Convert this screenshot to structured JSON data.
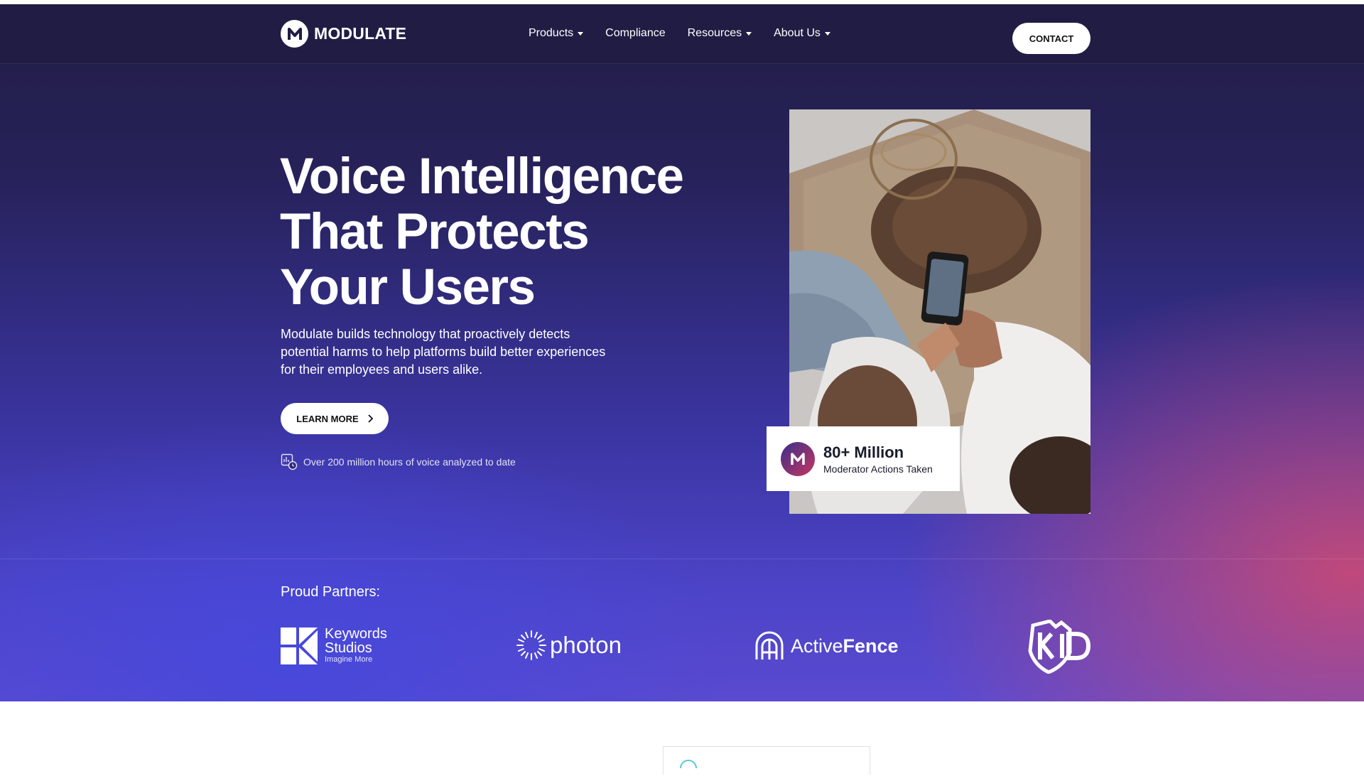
{
  "nav": {
    "logo_text": "MODULATE",
    "items": [
      {
        "label": "Products",
        "dropdown": true
      },
      {
        "label": "Compliance",
        "dropdown": false
      },
      {
        "label": "Resources",
        "dropdown": true
      },
      {
        "label": "About Us",
        "dropdown": true
      }
    ],
    "contact_label": "CONTACT"
  },
  "hero": {
    "headline_1": "Voice Intelligence",
    "headline_2": "That Protects",
    "headline_3": "Your Users",
    "subtext": "Modulate builds technology that proactively detects potential harms to help platforms build better experiences for their employees and users alike.",
    "cta_label": "LEARN MORE",
    "stat_text": "Over 200 million hours of voice analyzed to date"
  },
  "badge": {
    "title": "80+ Million",
    "subtitle": "Moderator Actions Taken"
  },
  "partners": {
    "title": "Proud Partners:",
    "items": [
      {
        "name": "Keywords Studios",
        "line1": "Keywords",
        "line2": "Studios",
        "tagline": "Imagine More"
      },
      {
        "name": "photon",
        "text": "photon"
      },
      {
        "name": "ActiveFence",
        "text_a": "Active",
        "text_b": "Fence"
      },
      {
        "name": "k-ID",
        "text": "kID"
      }
    ]
  },
  "colors": {
    "nav_bg": "#201c44",
    "hero_top": "#211d45",
    "hero_bottom": "#4d44c8",
    "accent_pink": "#d44a6e",
    "text_white": "#ffffff"
  }
}
